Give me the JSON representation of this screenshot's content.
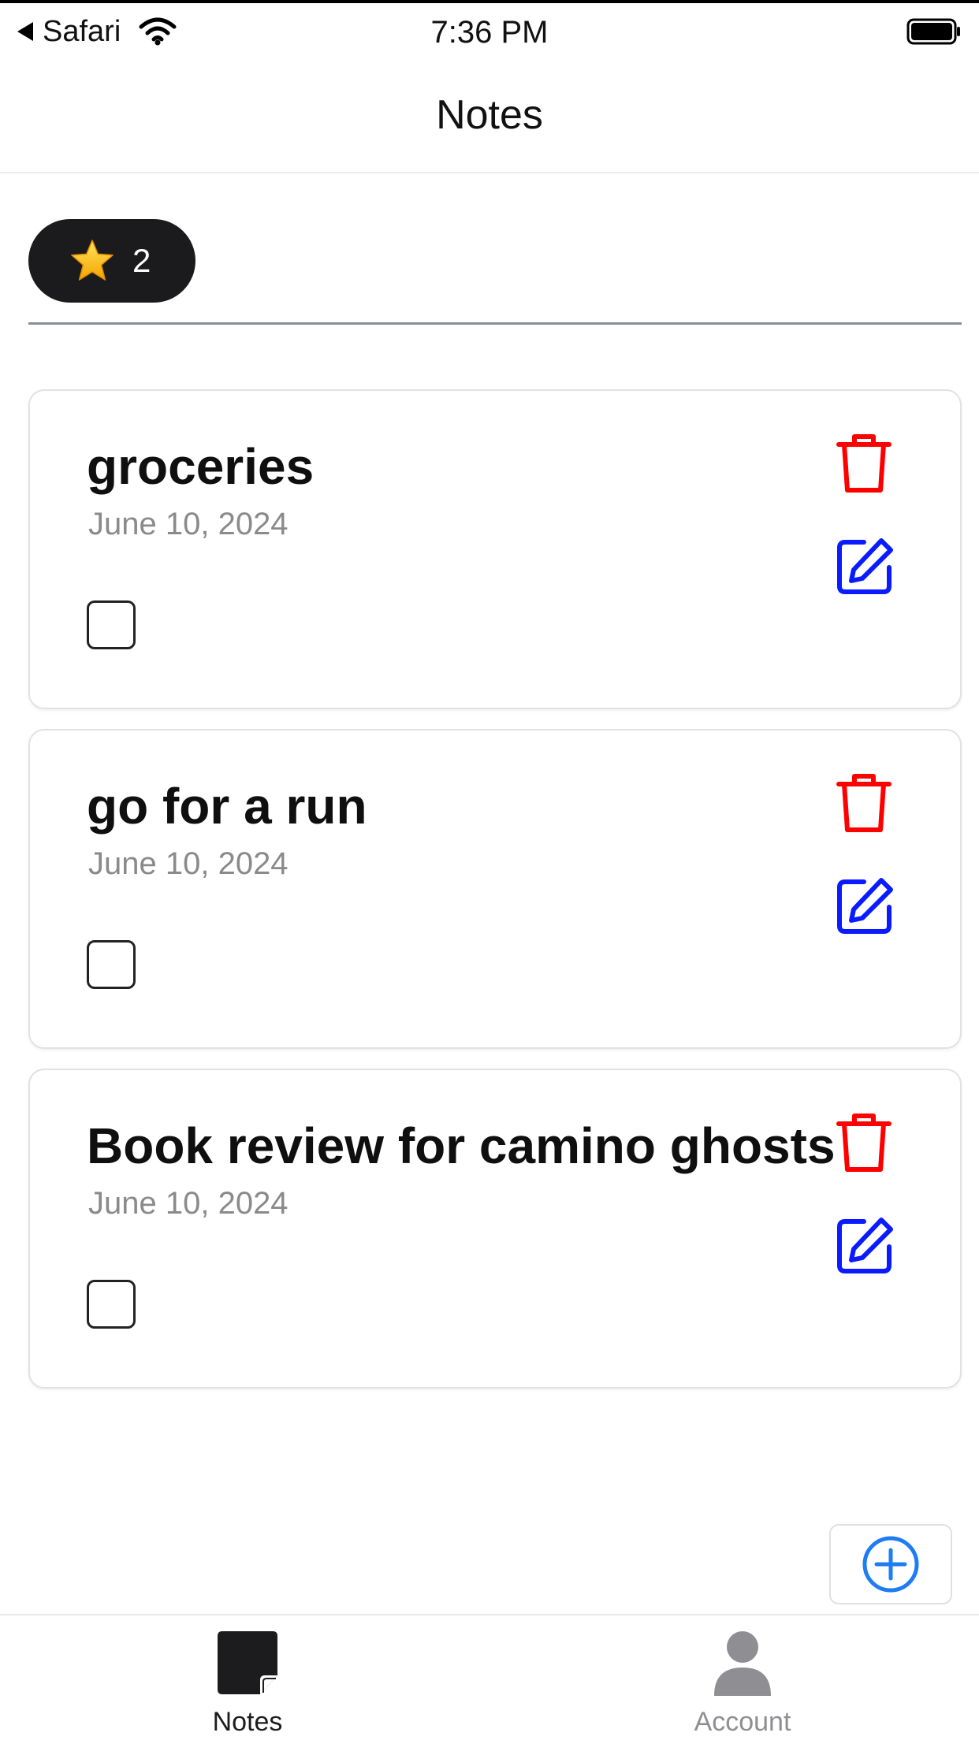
{
  "status_bar": {
    "back_label": "Safari",
    "time": "7:36 PM"
  },
  "nav": {
    "title": "Notes"
  },
  "star_badge": {
    "icon": "star-icon",
    "count": "2"
  },
  "notes": [
    {
      "title": "groceries",
      "date": "June 10, 2024",
      "checked": false
    },
    {
      "title": "go for a run",
      "date": "June 10, 2024",
      "checked": false
    },
    {
      "title": "Book review for camino ghosts",
      "date": "June 10, 2024",
      "checked": false
    }
  ],
  "colors": {
    "delete": "#ff0000",
    "edit": "#0a1cff",
    "add": "#1e7cf5",
    "badge_bg": "#1b1b1d"
  },
  "tabs": [
    {
      "label": "Notes",
      "icon": "note-icon",
      "active": true
    },
    {
      "label": "Account",
      "icon": "person-icon",
      "active": false
    }
  ]
}
